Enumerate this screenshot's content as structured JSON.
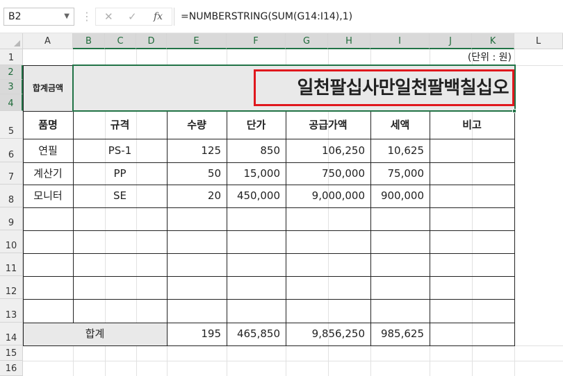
{
  "formula_bar": {
    "name_box": "B2",
    "cancel_icon": "✕",
    "enter_icon": "✓",
    "fx_label": "fx",
    "formula": "=NUMBERSTRING(SUM(G14:I14),1)"
  },
  "columns": [
    "A",
    "B",
    "C",
    "D",
    "E",
    "F",
    "G",
    "H",
    "I",
    "J",
    "K",
    "L"
  ],
  "rows": [
    "1",
    "2",
    "3",
    "4",
    "5",
    "6",
    "7",
    "8",
    "9",
    "10",
    "11",
    "12",
    "13",
    "14",
    "15",
    "16"
  ],
  "sheet": {
    "unit_note": "(단위 : 원)",
    "total_label": "합계금액",
    "total_korean": "일천팔십사만일천팔백칠십오",
    "headers": [
      "품명",
      "규격",
      "수량",
      "단가",
      "공급가액",
      "세액",
      "비고"
    ],
    "items": [
      {
        "name": "연필",
        "spec": "PS-1",
        "qty": "125",
        "price": "850",
        "supply": "106,250",
        "tax": "10,625",
        "note": ""
      },
      {
        "name": "계산기",
        "spec": "PP",
        "qty": "50",
        "price": "15,000",
        "supply": "750,000",
        "tax": "75,000",
        "note": ""
      },
      {
        "name": "모니터",
        "spec": "SE",
        "qty": "20",
        "price": "450,000",
        "supply": "9,000,000",
        "tax": "900,000",
        "note": ""
      }
    ],
    "sum_label": "합계",
    "sum": {
      "qty": "195",
      "price": "465,850",
      "supply": "9,856,250",
      "tax": "985,625"
    }
  },
  "colors": {
    "selection": "#217346",
    "highlight": "#e0171d",
    "header_fill": "#e9e9e9"
  }
}
